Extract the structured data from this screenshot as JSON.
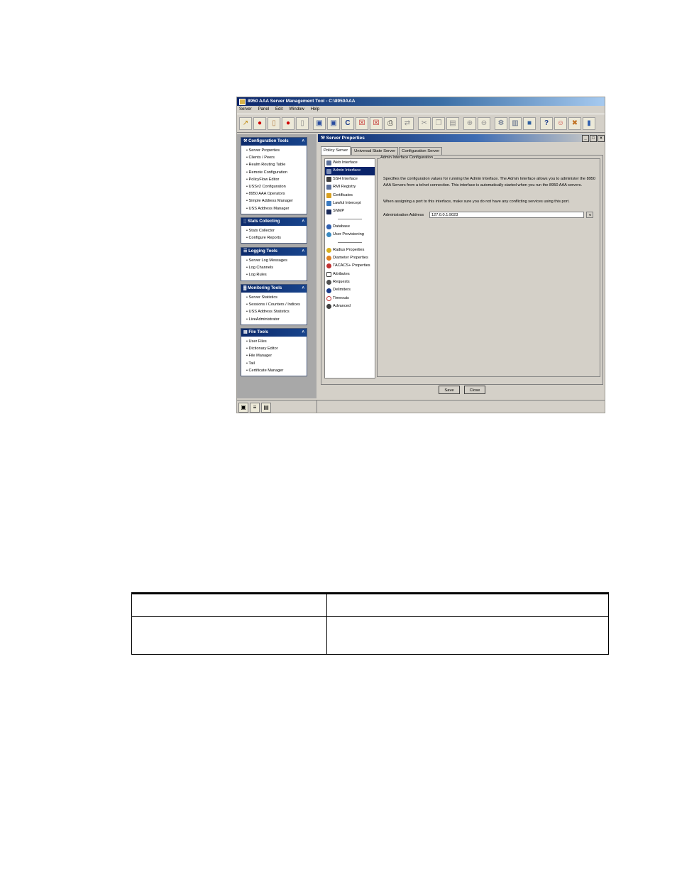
{
  "app": {
    "title": "8950 AAA Server Management Tool - C:\\8950AAA",
    "menu": [
      "Server",
      "Panel",
      "Edit",
      "Window",
      "Help"
    ],
    "toolbar_icons": [
      "connect-icon",
      "red-dot-icon",
      "document-icon",
      "red-dot-icon",
      "document-icon",
      "save-icon",
      "save-all-icon",
      "refresh-icon",
      "window-close-icon",
      "window-close-icon",
      "printer-icon",
      "sync-icon",
      "cut-icon",
      "copy-icon",
      "paste-icon",
      "zoom-in-icon",
      "zoom-out-icon",
      "settings-icon",
      "report-icon",
      "monitor-icon",
      "help-icon",
      "users-icon",
      "tools-icon",
      "database-icon"
    ]
  },
  "left_panels": [
    {
      "title": "Configuration Tools",
      "items": [
        "Server Properties",
        "Clients / Peers",
        "Realm Routing Table",
        "Remote Configuration",
        "PolicyFlow Editor",
        "USSv2 Configuration",
        "8950 AAA Operators",
        "Simple Address Manager",
        "USS Address Manager"
      ]
    },
    {
      "title": "Stats Collecting",
      "items": [
        "Stats Collector",
        "Configure Reports"
      ]
    },
    {
      "title": "Logging Tools",
      "items": [
        "Server Log Messages",
        "Log Channels",
        "Log Rules"
      ]
    },
    {
      "title": "Monitoring Tools",
      "items": [
        "Server Statistics",
        "Sessions / Counters / Indices",
        "USS Address Statistics",
        "LiveAdministrator"
      ]
    },
    {
      "title": "File Tools",
      "items": [
        "User Files",
        "Dictionary Editor",
        "File Manager",
        "Tail",
        "Certificate Manager"
      ]
    }
  ],
  "server_properties": {
    "title": "Server Properties",
    "tabs": [
      "Policy Server",
      "Universal State Server",
      "Configuration Server"
    ],
    "nav_group1": [
      "Web Interface",
      "Admin Interface",
      "SSH Interface",
      "RMI Registry",
      "Certificates",
      "Lawful Intercept",
      "SNMP"
    ],
    "nav_group2": [
      "Database",
      "User Provisioning"
    ],
    "nav_group3": [
      "Radius Properties",
      "Diameter Properties",
      "TACACS+ Properties",
      "Attributes",
      "Requests",
      "Delimiters",
      "Timeouts",
      "Advanced"
    ],
    "selected_nav": "Admin Interface",
    "section_title": "Admin Interface Configuration",
    "description": "Specifies the configuration values for running the Admin Interface. The Admin Interface allows you to administer the 8950 AAA Servers from a telnet connection. This interface is automatically started when you run the 8950 AAA servers.",
    "note": "When assigning a port to this interface, make sure you do not have any conflicting services using this port.",
    "address_label": "Administration Address",
    "address_value": "127.0.0.1:9023",
    "save_label": "Save",
    "close_label": "Close"
  }
}
